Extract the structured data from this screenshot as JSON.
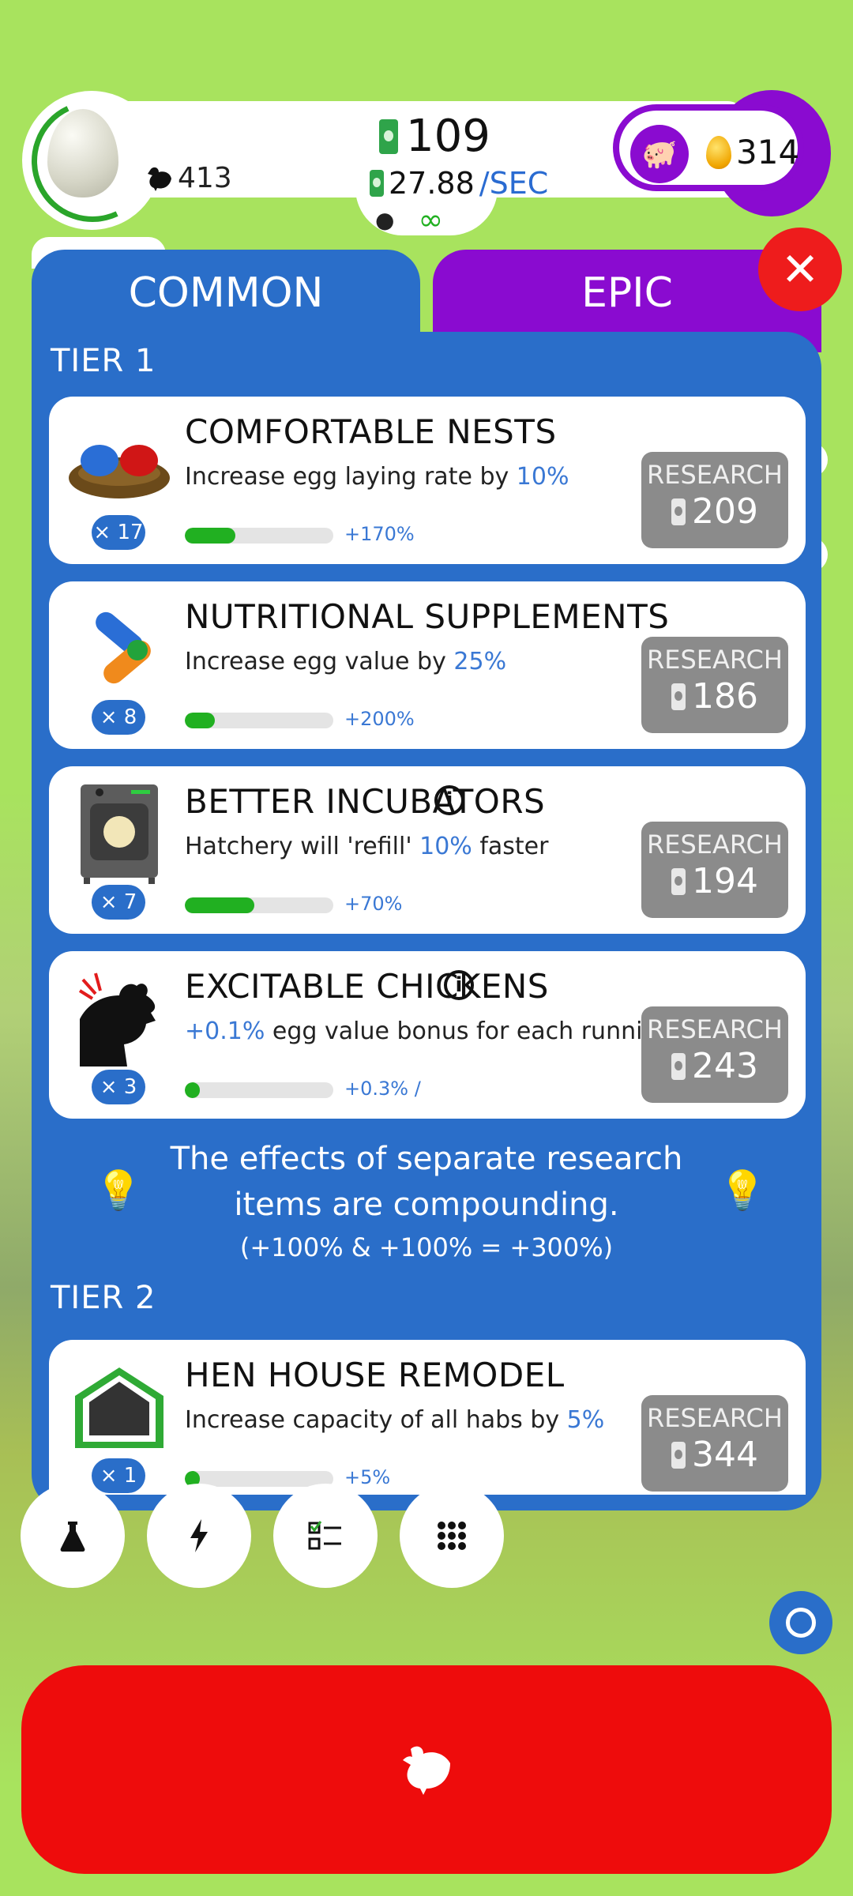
{
  "header": {
    "chicken_count": "413",
    "money": "109",
    "money_rate": "27.88",
    "rate_unit": "/SEC",
    "infinity": "∞",
    "golden_eggs": "314"
  },
  "tabs": [
    {
      "label": "COMMON",
      "active": true
    },
    {
      "label": "EPIC",
      "active": false
    }
  ],
  "tiers": [
    {
      "label": "TIER 1"
    },
    {
      "label": "TIER 2"
    }
  ],
  "research_items": [
    {
      "title": "COMFORTABLE NESTS",
      "desc_pre": "Increase egg laying rate by ",
      "desc_hl": "10%",
      "desc_post": "",
      "level": "× 17",
      "bonus": "+170%",
      "progress": 0.34,
      "button_label": "RESEARCH",
      "cost": "209",
      "icon": "nest-icon",
      "has_info": false
    },
    {
      "title": "NUTRITIONAL SUPPLEMENTS",
      "desc_pre": "Increase egg value by ",
      "desc_hl": "25%",
      "desc_post": "",
      "level": "× 8",
      "bonus": "+200%",
      "progress": 0.2,
      "button_label": "RESEARCH",
      "cost": "186",
      "icon": "pill-icon",
      "has_info": false
    },
    {
      "title": "BETTER INCUBATORS",
      "desc_pre": "Hatchery will 'refill' ",
      "desc_hl": "10%",
      "desc_post": " faster",
      "level": "× 7",
      "bonus": "+70%",
      "progress": 0.47,
      "button_label": "RESEARCH",
      "cost": "194",
      "icon": "incubator-icon",
      "has_info": true
    },
    {
      "title": "EXCITABLE CHICKENS",
      "desc_pre": "",
      "desc_hl": "+0.1%",
      "desc_post": " egg value bonus for each running chicken",
      "level": "× 3",
      "bonus": "+0.3% /",
      "progress": 0.1,
      "button_label": "RESEARCH",
      "cost": "243",
      "icon": "chicken-head-icon",
      "has_info": true
    },
    {
      "title": "HEN HOUSE REMODEL",
      "desc_pre": "Increase capacity of all habs by ",
      "desc_hl": "5%",
      "desc_post": "",
      "level": "× 1",
      "bonus": "+5%",
      "progress": 0.1,
      "button_label": "RESEARCH",
      "cost": "344",
      "icon": "house-icon",
      "has_info": false
    }
  ],
  "tip": {
    "line1": "The effects of separate research items are compounding.",
    "line2": "(+100% & +100% = +300%)"
  },
  "bottom": {
    "buttons": [
      "flask-icon",
      "lightning-icon",
      "checklist-icon",
      "grid-icon"
    ]
  },
  "colors": {
    "background": "#a8e35e",
    "panel_blue": "#2a6ec9",
    "epic_purple": "#8a0bd0",
    "hatch_red": "#ee0c0c",
    "progress_green": "#21b021"
  }
}
